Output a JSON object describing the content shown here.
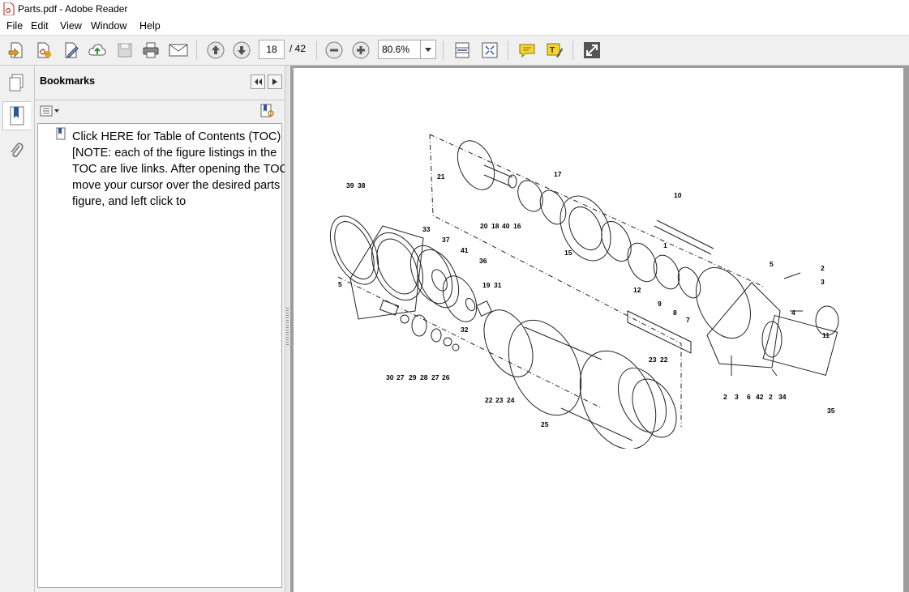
{
  "window": {
    "title": "Parts.pdf - Adobe Reader"
  },
  "menu": [
    "File",
    "Edit",
    "View",
    "Window",
    "Help"
  ],
  "toolbar": {
    "current_page": "18",
    "total_pages": "/ 42",
    "zoom": "80.6%"
  },
  "sidebar": {
    "title": "Bookmarks",
    "bookmark_text": "Click HERE for Table of Contents (TOC) [NOTE: each of the figure listings in the TOC are live links. After opening the TOC, move your cursor over the desired parts figure, and left click to"
  },
  "diagram": {
    "part_labels": [
      "39",
      "38",
      "21",
      "20",
      "18",
      "40",
      "16",
      "17",
      "10",
      "33",
      "37",
      "41",
      "36",
      "19",
      "31",
      "32",
      "5",
      "1",
      "15",
      "12",
      "9",
      "8",
      "2",
      "3",
      "4",
      "11",
      "7",
      "30",
      "27",
      "29",
      "28",
      "27",
      "26",
      "22",
      "23",
      "24",
      "25",
      "23",
      "22",
      "6",
      "42",
      "2",
      "34",
      "35",
      "2",
      "3",
      "5"
    ]
  },
  "colors": {
    "accent": "#2b5797",
    "pdf_red": "#c0392b"
  }
}
